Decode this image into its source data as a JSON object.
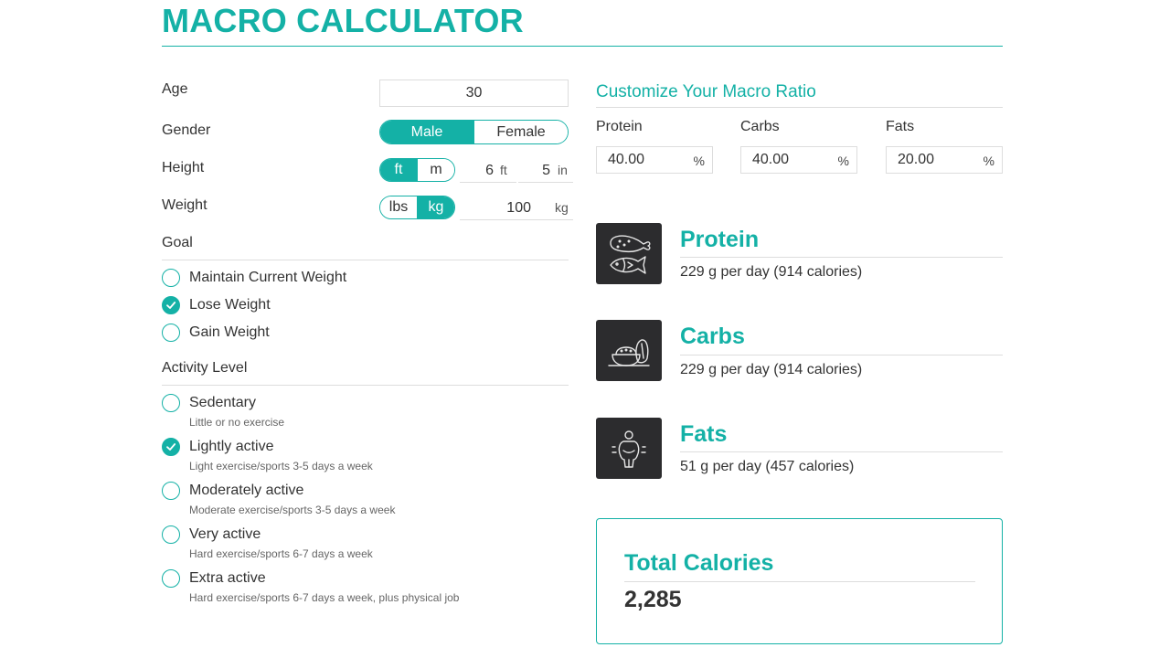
{
  "title": "MACRO CALCULATOR",
  "colors": {
    "accent": "#14b1a6",
    "icon_bg": "#2c2c2e"
  },
  "form": {
    "age": {
      "label": "Age",
      "value": "30"
    },
    "gender": {
      "label": "Gender",
      "options": [
        "Male",
        "Female"
      ],
      "selected": "Male"
    },
    "height": {
      "label": "Height",
      "units": [
        "ft",
        "m"
      ],
      "selected_unit": "ft",
      "feet": "6",
      "feet_unit": "ft",
      "inches": "5",
      "inches_unit": "in"
    },
    "weight": {
      "label": "Weight",
      "units": [
        "lbs",
        "kg"
      ],
      "selected_unit": "kg",
      "value": "100",
      "value_unit": "kg"
    },
    "goal": {
      "label": "Goal",
      "options": [
        {
          "label": "Maintain Current Weight",
          "checked": false
        },
        {
          "label": "Lose Weight",
          "checked": true
        },
        {
          "label": "Gain Weight",
          "checked": false
        }
      ]
    },
    "activity": {
      "label": "Activity Level",
      "options": [
        {
          "label": "Sedentary",
          "desc": "Little or no exercise",
          "checked": false
        },
        {
          "label": "Lightly active",
          "desc": "Light exercise/sports 3-5 days a week",
          "checked": true
        },
        {
          "label": "Moderately active",
          "desc": "Moderate exercise/sports 3-5 days a week",
          "checked": false
        },
        {
          "label": "Very active",
          "desc": "Hard exercise/sports 6-7 days a week",
          "checked": false
        },
        {
          "label": "Extra active",
          "desc": "Hard exercise/sports 6-7 days a week, plus physical job",
          "checked": false
        }
      ]
    }
  },
  "ratio": {
    "title": "Customize Your Macro Ratio",
    "protein": {
      "label": "Protein",
      "value": "40.00",
      "unit": "%"
    },
    "carbs": {
      "label": "Carbs",
      "value": "40.00",
      "unit": "%"
    },
    "fats": {
      "label": "Fats",
      "value": "20.00",
      "unit": "%"
    }
  },
  "results": {
    "protein": {
      "name": "Protein",
      "text": "229 g per day (914 calories)",
      "icon": "chicken-fish-icon"
    },
    "carbs": {
      "name": "Carbs",
      "text": "229 g per day (914 calories)",
      "icon": "bread-bowl-icon"
    },
    "fats": {
      "name": "Fats",
      "text": "51 g per day (457 calories)",
      "icon": "body-fat-icon"
    }
  },
  "total": {
    "title": "Total Calories",
    "value": "2,285"
  }
}
